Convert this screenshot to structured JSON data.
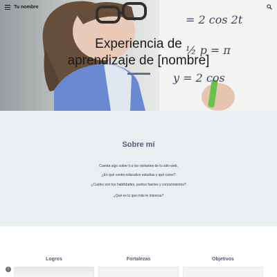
{
  "header": {
    "site_name": "Tu nombre",
    "menu_icon": "menu-icon",
    "search_icon": "search-icon"
  },
  "hero": {
    "title_line1": "Experiencia de",
    "title_line2": "aprendizaje de [nombre]",
    "board_text_1": "y = 2 cos 2t",
    "board_text_2": "1/2 p = π",
    "board_text_3": "y = 2 cos"
  },
  "about": {
    "title": "Sobre mí",
    "lines": [
      "Cuenta algo sobre ti a los visitantes de tu sitio web.",
      "¿En qué centro educativo estudias y qué curso?",
      "¿Cuáles son tus habilidades, puntos fuertes y conocimientos?",
      "¿Qué es lo que más te interesa?"
    ]
  },
  "sections": {
    "cards": [
      {
        "title": "Logros"
      },
      {
        "title": "Fortalezas"
      },
      {
        "title": "Objetivos"
      }
    ]
  },
  "colors": {
    "accent": "#5f6f9a",
    "about_bg": "#e9eef0",
    "heading": "#555c78"
  }
}
